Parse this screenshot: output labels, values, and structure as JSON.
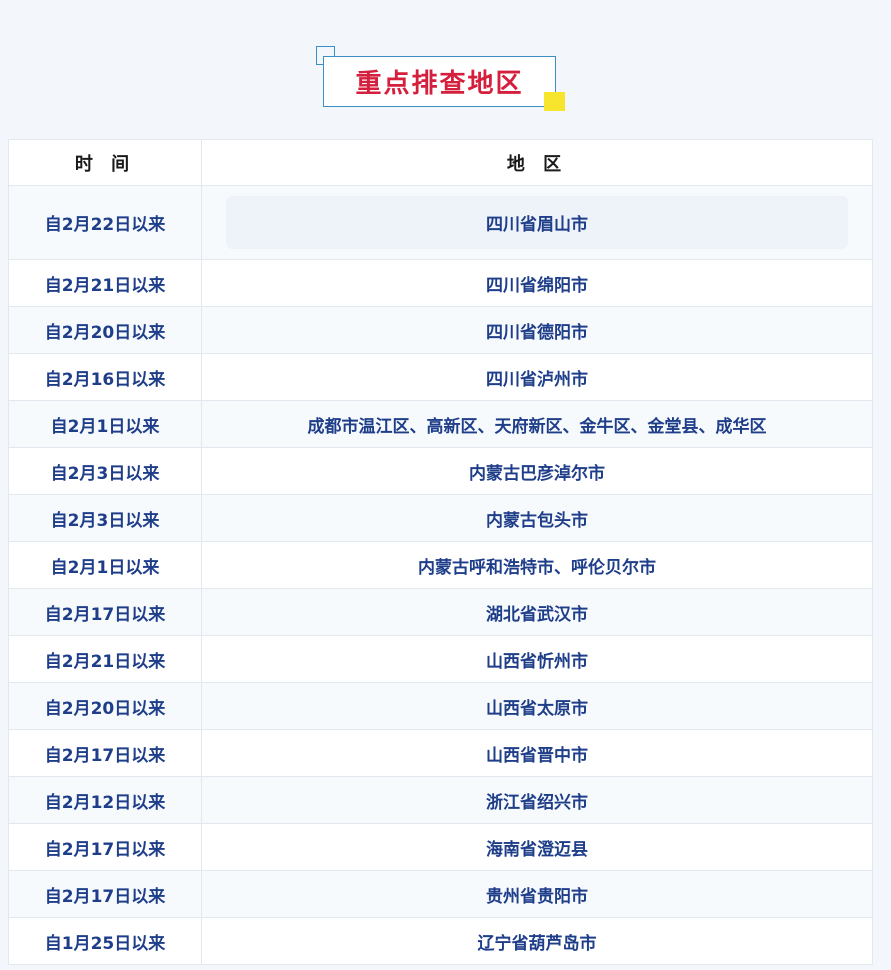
{
  "title": "重点排查地区",
  "table": {
    "headers": [
      "时 间",
      "地 区"
    ],
    "rows": [
      {
        "time": "自2月22日以来",
        "area": "四川省眉山市"
      },
      {
        "time": "自2月21日以来",
        "area": "四川省绵阳市"
      },
      {
        "time": "自2月20日以来",
        "area": "四川省德阳市"
      },
      {
        "time": "自2月16日以来",
        "area": "四川省泸州市"
      },
      {
        "time": "自2月1日以来",
        "area": "成都市温江区、高新区、天府新区、金牛区、金堂县、成华区"
      },
      {
        "time": "自2月3日以来",
        "area": "内蒙古巴彦淖尔市"
      },
      {
        "time": "自2月3日以来",
        "area": "内蒙古包头市"
      },
      {
        "time": "自2月1日以来",
        "area": "内蒙古呼和浩特市、呼伦贝尔市"
      },
      {
        "time": "自2月17日以来",
        "area": "湖北省武汉市"
      },
      {
        "time": "自2月21日以来",
        "area": "山西省忻州市"
      },
      {
        "time": "自2月20日以来",
        "area": "山西省太原市"
      },
      {
        "time": "自2月17日以来",
        "area": "山西省晋中市"
      },
      {
        "time": "自2月12日以来",
        "area": "浙江省绍兴市"
      },
      {
        "time": "自2月17日以来",
        "area": "海南省澄迈县"
      },
      {
        "time": "自2月17日以来",
        "area": "贵州省贵阳市"
      },
      {
        "time": "自1月25日以来",
        "area": "辽宁省葫芦岛市"
      }
    ]
  },
  "colors": {
    "title_red": "#d41f3d",
    "frame_blue": "#3c8fc2",
    "accent_yellow": "#f7e42c",
    "cell_text": "#1f3e8a"
  }
}
